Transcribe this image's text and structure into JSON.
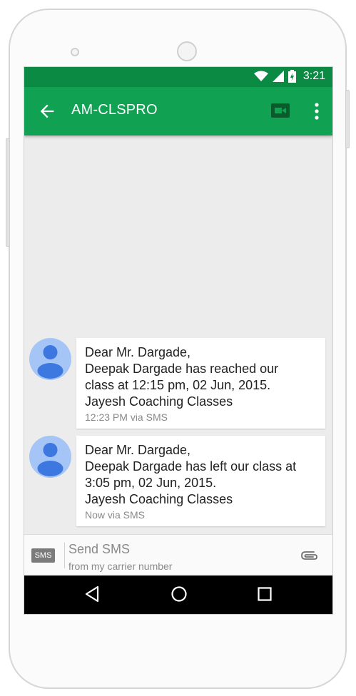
{
  "status_bar": {
    "time": "3:21",
    "icons": [
      "wifi-icon",
      "signal-icon",
      "battery-charging-icon"
    ]
  },
  "app_bar": {
    "title": "AM-CLSPRO",
    "icons": [
      "back-arrow-icon",
      "video-call-icon",
      "more-vert-icon"
    ]
  },
  "messages": [
    {
      "lines": [
        "Dear Mr. Dargade,",
        "Deepak Dargade has reached our",
        "class at 12:15 pm, 02 Jun, 2015.",
        "Jayesh Coaching Classes"
      ],
      "meta": "12:23 PM via SMS"
    },
    {
      "lines": [
        "Dear Mr. Dargade,",
        "Deepak Dargade has left our class at",
        "3:05 pm, 02 Jun, 2015.",
        "Jayesh Coaching Classes"
      ],
      "meta": "Now via SMS"
    }
  ],
  "composer": {
    "badge": "SMS",
    "placeholder": "Send SMS",
    "subtext": "from my carrier number",
    "attach_icon": "attachment-icon"
  },
  "nav_bar": {
    "icons": [
      "back-triangle-icon",
      "home-circle-icon",
      "recents-square-icon"
    ]
  },
  "colors": {
    "status_bar": "#0b8a43",
    "app_bar": "#10a152",
    "avatar": "#a5c5f6",
    "avatar_figure": "#3d78e0"
  }
}
